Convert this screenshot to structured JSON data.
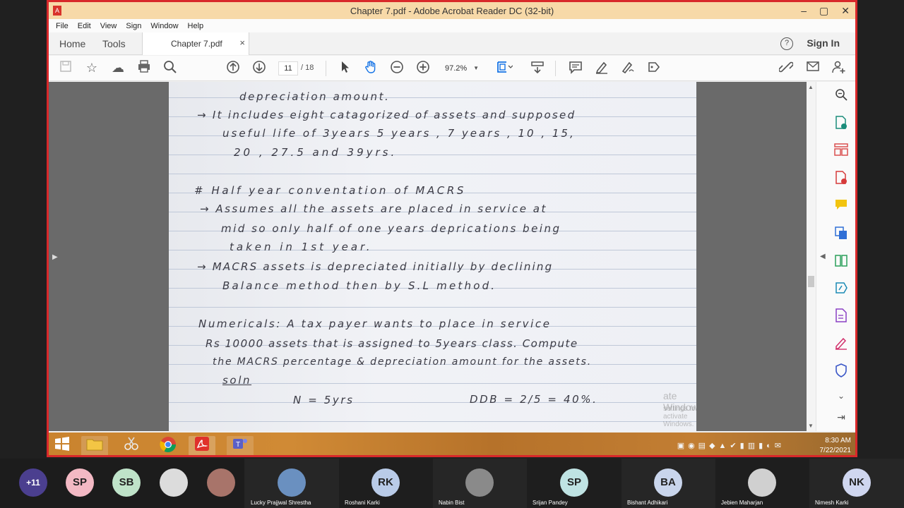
{
  "window": {
    "title": "Chapter 7.pdf - Adobe Acrobat Reader DC (32-bit)",
    "minimize": "–",
    "maximize": "▢",
    "close": "✕"
  },
  "menu": [
    "File",
    "Edit",
    "View",
    "Sign",
    "Window",
    "Help"
  ],
  "tabs": {
    "home": "Home",
    "tools": "Tools",
    "document": "Chapter 7.pdf",
    "close": "×",
    "help": "?",
    "sign_in": "Sign In"
  },
  "toolbar": {
    "current_page": "11",
    "page_total": "/ 18",
    "zoom": "97.2%"
  },
  "document": {
    "lines": [
      "depreciation amount.",
      "→   It includes eight catagorized of assets and supposed",
      "useful life of 3years   5 years , 7 years , 10 , 15,",
      "20 , 27.5 and 39yrs.",
      "#  Half year conventation of MACRS",
      "→   Assumes all the assets are placed in service at",
      "mid so only half of one years deprications being",
      "taken in 1st year.",
      "→   MACRS assets is depreciated initially by declining",
      "Balance method then by S.L method.",
      "Numericals:   A tax payer wants to place in service",
      "Rs 10000 assets that is assigned to 5years class. Compute",
      "the MACRS percentage & depreciation amount for the assets.",
      "soln",
      "N = 5yrs",
      "DDB = 2/5 = 40%."
    ]
  },
  "watermark": {
    "line1": "ate Windows",
    "line2": "settings to activate Windows."
  },
  "taskbar": {
    "time": "8:30 AM",
    "date": "7/22/2021"
  },
  "participants": [
    {
      "initials": "+11",
      "name": "",
      "color": "#4b3f8f"
    },
    {
      "initials": "SP",
      "name": "",
      "color": "#f3b9c4"
    },
    {
      "initials": "SB",
      "name": "",
      "color": "#bfe3c9"
    },
    {
      "initials": "",
      "name": "",
      "color": "#dcdcdc"
    },
    {
      "initials": "",
      "name": "",
      "color": "#a8746a"
    },
    {
      "initials": "",
      "name": "Lucky Prajjwal Shrestha",
      "color": "#6a90c0"
    },
    {
      "initials": "RK",
      "name": "Roshani Karki",
      "color": "#b9cbe8"
    },
    {
      "initials": "",
      "name": "Nabin Bist",
      "color": "#8a8a8a"
    },
    {
      "initials": "SP",
      "name": "Srijan Pandey",
      "color": "#bfe3e3"
    },
    {
      "initials": "BA",
      "name": "Bishant Adhikari",
      "color": "#c9d5ec"
    },
    {
      "initials": "",
      "name": "Jebien Maharjan",
      "color": "#d0d0d0"
    },
    {
      "initials": "NK",
      "name": "Nimesh Karki",
      "color": "#cfd6ef"
    }
  ]
}
